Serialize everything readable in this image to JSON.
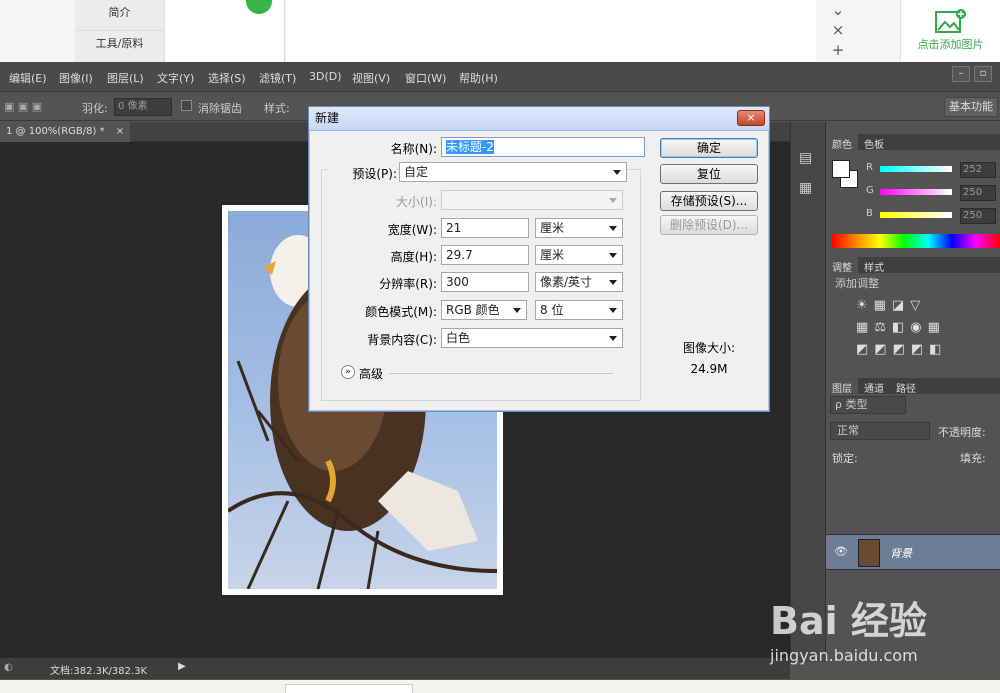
{
  "web": {
    "left_nav": [
      "简介",
      "工具/原料"
    ],
    "add_image_label": "点击添加图片",
    "controls": [
      "⌄",
      "×",
      "+"
    ]
  },
  "menu": [
    "编辑(E)",
    "图像(I)",
    "图层(L)",
    "文字(Y)",
    "选择(S)",
    "滤镜(T)",
    "3D(D)",
    "视图(V)",
    "窗口(W)",
    "帮助(H)"
  ],
  "options_bar": {
    "feather_label": "羽化:",
    "feather_value": "0 像素",
    "antialias_label": "消除锯齿",
    "style_label": "样式:",
    "workspace": "基本功能"
  },
  "document_tab": "1 @ 100%(RGB/8) *",
  "tab_close": "×",
  "status": {
    "doc_info": "文档:382.3K/382.3K"
  },
  "panels": {
    "color_tabs": [
      "颜色",
      "色板"
    ],
    "rgb": [
      {
        "label": "R",
        "value": "252"
      },
      {
        "label": "G",
        "value": "250"
      },
      {
        "label": "B",
        "value": "250"
      }
    ],
    "adjust_tabs": [
      "调整",
      "样式"
    ],
    "adjust_title": "添加调整",
    "layers_tabs": [
      "图层",
      "通道",
      "路径"
    ],
    "layer_kind": "ρ 类型",
    "blend_mode": "正常",
    "opacity_label": "不透明度:",
    "lock_label": "锁定:",
    "fill_label": "填充:",
    "layer_name": "背景"
  },
  "dialog": {
    "title": "新建",
    "close": "×",
    "name_label": "名称(N):",
    "name_value": "未标题-2",
    "preset_label": "预设(P):",
    "preset_value": "自定",
    "size_label": "大小(I):",
    "width_label": "宽度(W):",
    "width_value": "21",
    "width_unit": "厘米",
    "height_label": "高度(H):",
    "height_value": "29.7",
    "height_unit": "厘米",
    "resolution_label": "分辨率(R):",
    "resolution_value": "300",
    "resolution_unit": "像素/英寸",
    "color_mode_label": "颜色模式(M):",
    "color_mode_value": "RGB 颜色",
    "bit_depth_value": "8 位",
    "background_label": "背景内容(C):",
    "background_value": "白色",
    "advanced_label": "高级",
    "ok_button": "确定",
    "reset_button": "复位",
    "save_preset_button": "存储预设(S)...",
    "delete_preset_button": "删除预设(D)...",
    "image_size_label": "图像大小:",
    "image_size_value": "24.9M"
  },
  "watermark": {
    "brand": "Bai 经验",
    "url": "jingyan.baidu.com"
  }
}
